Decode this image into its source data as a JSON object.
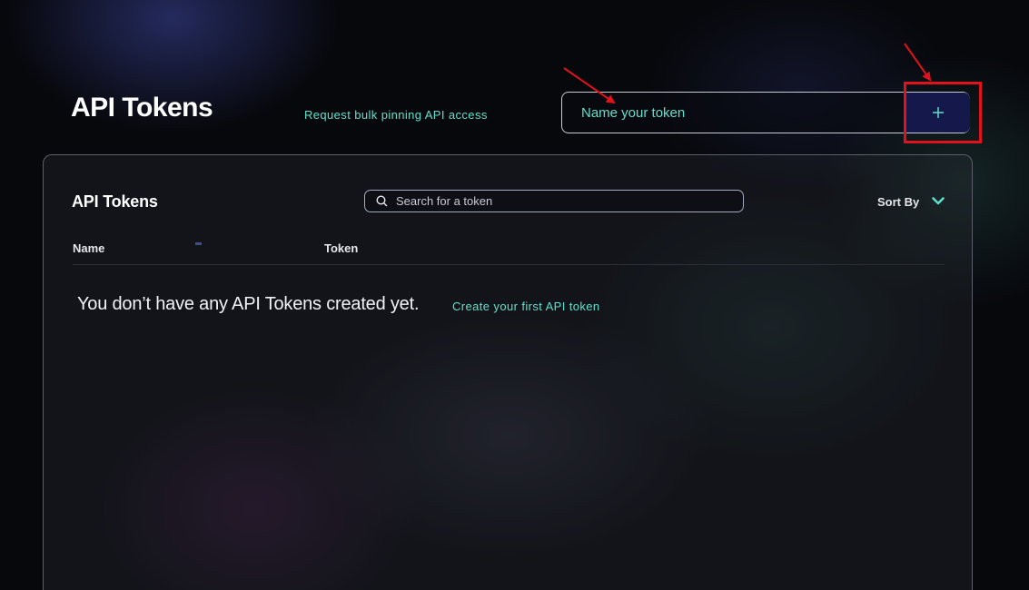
{
  "header": {
    "title": "API Tokens",
    "bulk_link": "Request bulk pinning API access",
    "token_input_placeholder": "Name your token",
    "add_button_label": "+"
  },
  "panel": {
    "title": "API Tokens",
    "search_placeholder": "Search for a token",
    "sort_label": "Sort By",
    "columns": [
      "Name",
      "Token"
    ],
    "empty_message": "You don’t have any API Tokens created yet.",
    "create_link": "Create your first API token"
  },
  "icons": {
    "add": "plus-icon",
    "search": "search-icon",
    "sort": "chevron-down-icon"
  },
  "colors": {
    "accent": "#5fe0cc",
    "add_button_bg": "#14184a",
    "annotation": "#e0121b",
    "background": "#07080c"
  }
}
